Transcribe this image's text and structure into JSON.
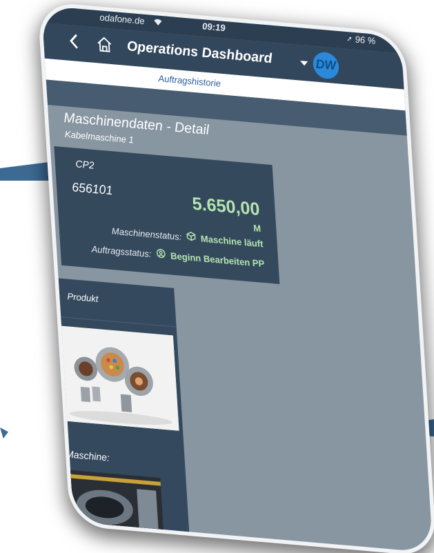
{
  "status_bar": {
    "carrier": "odafone.de",
    "time": "09:19",
    "battery": "96 %"
  },
  "shellbar": {
    "title": "Operations Dashboard",
    "avatar_initials": "DW"
  },
  "subheader": {
    "label": "Auftragshistorie"
  },
  "page": {
    "title": "Maschinendaten - Detail",
    "subtitle": "Kabelmaschine 1"
  },
  "detail": {
    "cp": "CP2",
    "order_number": "656101",
    "quantity": "5.650,00",
    "unit": "M",
    "machine_status_label": "Maschinenstatus:",
    "machine_status_value": "Maschine läuft",
    "order_status_label": "Auftragsstatus:",
    "order_status_value": "Beginn Bearbeiten PP"
  },
  "product_tile": {
    "header": "Produkt",
    "machine_label": "Maschine:"
  },
  "icons": {
    "back": "chevron-left-icon",
    "home": "home-icon",
    "menu": "caret-down-icon",
    "machine_status": "cube-icon",
    "order_status": "person-icon"
  },
  "colors": {
    "shell": "#33475c",
    "status_green": "#b3e5b0",
    "avatar": "#2c89d9",
    "link_blue": "#2c5f9a"
  }
}
